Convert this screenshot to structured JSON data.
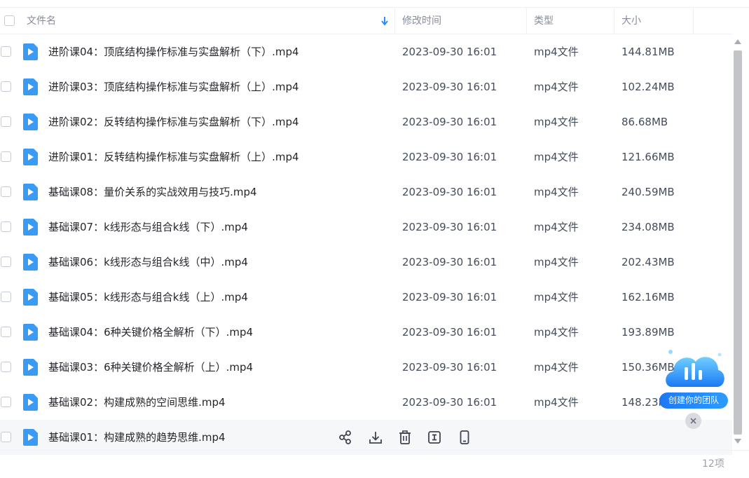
{
  "header": {
    "name": "文件名",
    "time": "修改时间",
    "type": "类型",
    "size": "大小"
  },
  "files": [
    {
      "name": "进阶课04：顶底结构操作标准与实盘解析（下）.mp4",
      "time": "2023-09-30 16:01",
      "type": "mp4文件",
      "size": "144.81MB"
    },
    {
      "name": "进阶课03：顶底结构操作标准与实盘解析（上）.mp4",
      "time": "2023-09-30 16:01",
      "type": "mp4文件",
      "size": "102.24MB"
    },
    {
      "name": "进阶课02：反转结构操作标准与实盘解析（下）.mp4",
      "time": "2023-09-30 16:01",
      "type": "mp4文件",
      "size": "86.68MB"
    },
    {
      "name": "进阶课01：反转结构操作标准与实盘解析（上）.mp4",
      "time": "2023-09-30 16:01",
      "type": "mp4文件",
      "size": "121.66MB"
    },
    {
      "name": "基础课08：量价关系的实战效用与技巧.mp4",
      "time": "2023-09-30 16:01",
      "type": "mp4文件",
      "size": "240.59MB"
    },
    {
      "name": "基础课07：k线形态与组合k线（下）.mp4",
      "time": "2023-09-30 16:01",
      "type": "mp4文件",
      "size": "234.08MB"
    },
    {
      "name": "基础课06：k线形态与组合k线（中）.mp4",
      "time": "2023-09-30 16:01",
      "type": "mp4文件",
      "size": "202.43MB"
    },
    {
      "name": "基础课05：k线形态与组合k线（上）.mp4",
      "time": "2023-09-30 16:01",
      "type": "mp4文件",
      "size": "162.16MB"
    },
    {
      "name": "基础课04：6种关键价格全解析（下）.mp4",
      "time": "2023-09-30 16:01",
      "type": "mp4文件",
      "size": "193.89MB"
    },
    {
      "name": "基础课03：6种关键价格全解析（上）.mp4",
      "time": "2023-09-30 16:01",
      "type": "mp4文件",
      "size": "150.36MB"
    },
    {
      "name": "基础课02：构建成熟的空间思维.mp4",
      "time": "2023-09-30 16:01",
      "type": "mp4文件",
      "size": "148.23MB"
    },
    {
      "name": "基础课01：构建成熟的趋势思维.mp4",
      "time": "",
      "type": "",
      "size": ""
    }
  ],
  "footer": {
    "count": "12项"
  },
  "team_badge": {
    "label": "创建你的团队"
  },
  "colors": {
    "accent": "#2c8ef8",
    "file_icon": "#3a9bf5",
    "border": "#eef0f3"
  },
  "icons": [
    "sort-down-icon",
    "video-file-icon",
    "share-icon",
    "download-icon",
    "delete-icon",
    "rename-icon",
    "phone-icon",
    "close-icon"
  ]
}
